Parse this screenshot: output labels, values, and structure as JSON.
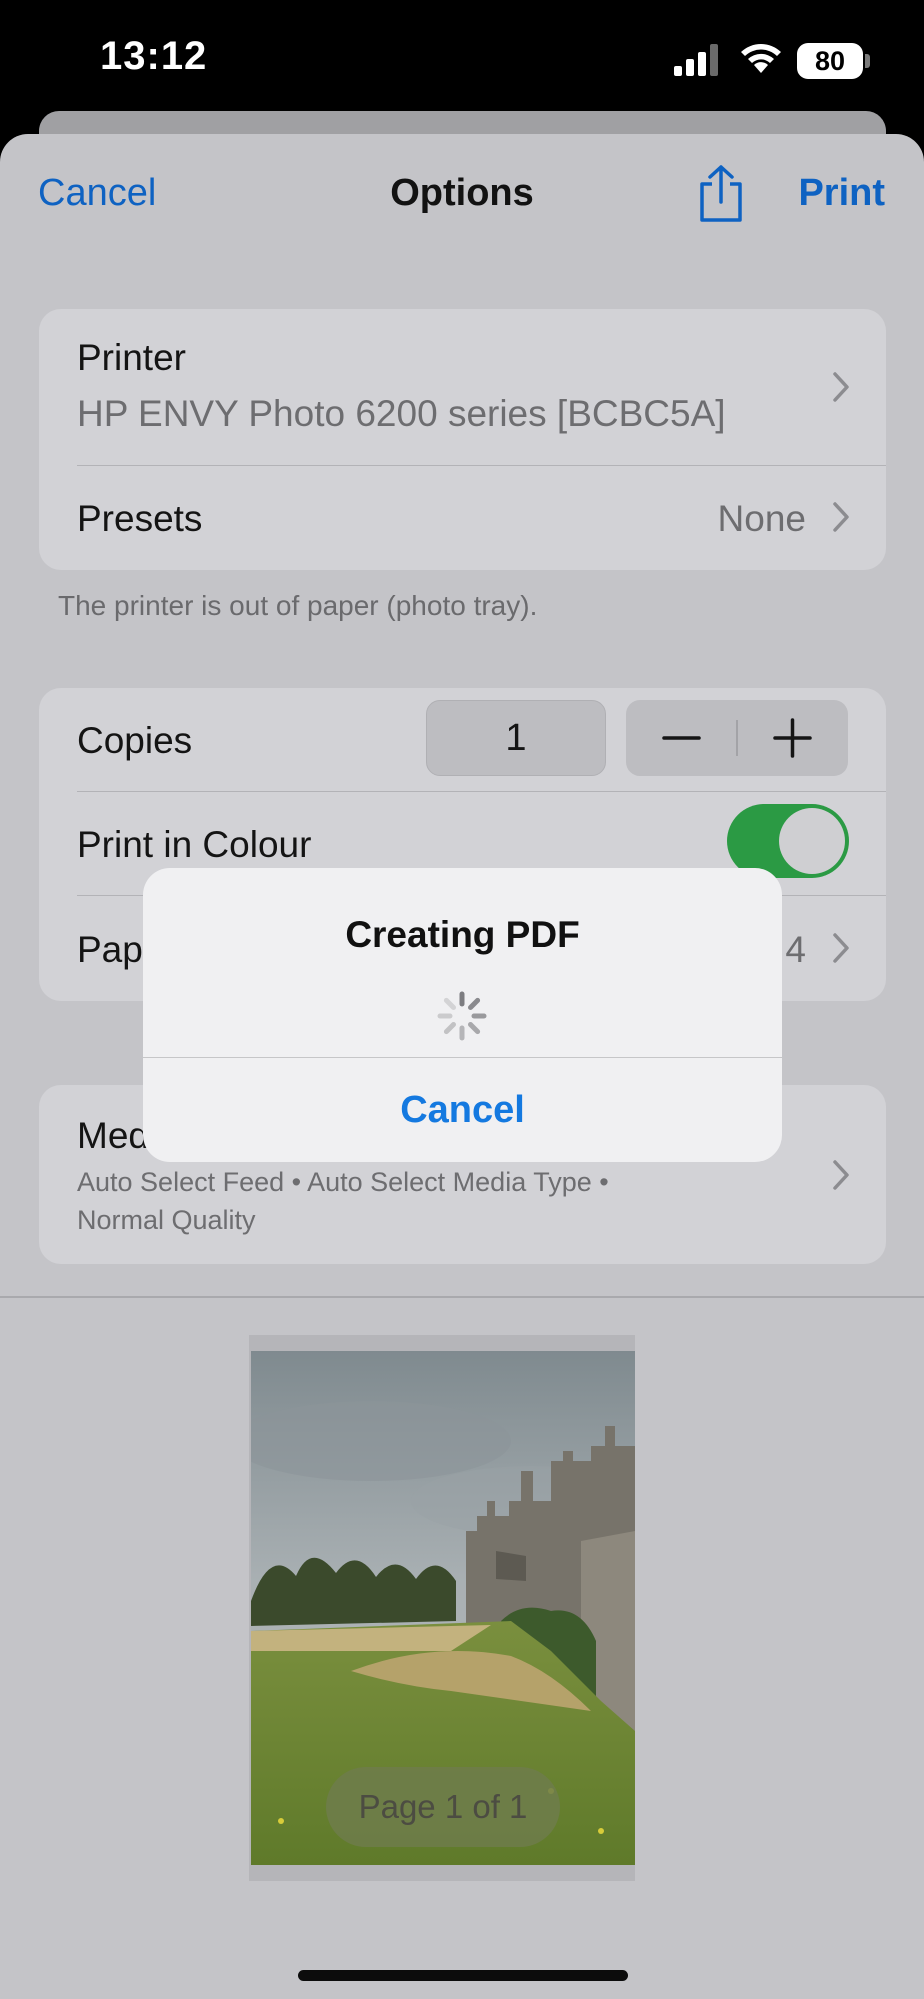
{
  "status_bar": {
    "time": "13:12",
    "battery": "80"
  },
  "nav": {
    "cancel_label": "Cancel",
    "title": "Options",
    "print_label": "Print"
  },
  "printer_group": {
    "printer_label": "Printer",
    "printer_value": "HP ENVY Photo 6200 series [BCBC5A]",
    "presets_label": "Presets",
    "presets_value": "None"
  },
  "printer_note": "The printer is out of paper (photo tray).",
  "options_group": {
    "copies_label": "Copies",
    "copies_value": "1",
    "colour_label": "Print in Colour",
    "colour_on": true,
    "paper_label": "Pap",
    "paper_value": "4"
  },
  "media_group": {
    "media_label": "Med",
    "media_detail_1": "Auto Select Feed • Auto Select Media Type •",
    "media_detail_2": "Normal Quality"
  },
  "preview": {
    "page_indicator": "Page 1 of 1"
  },
  "alert": {
    "title": "Creating PDF",
    "cancel_label": "Cancel"
  },
  "colors": {
    "accent": "#0e62c2",
    "toggle_on": "#2b9a44",
    "alert_button": "#1479e0"
  }
}
